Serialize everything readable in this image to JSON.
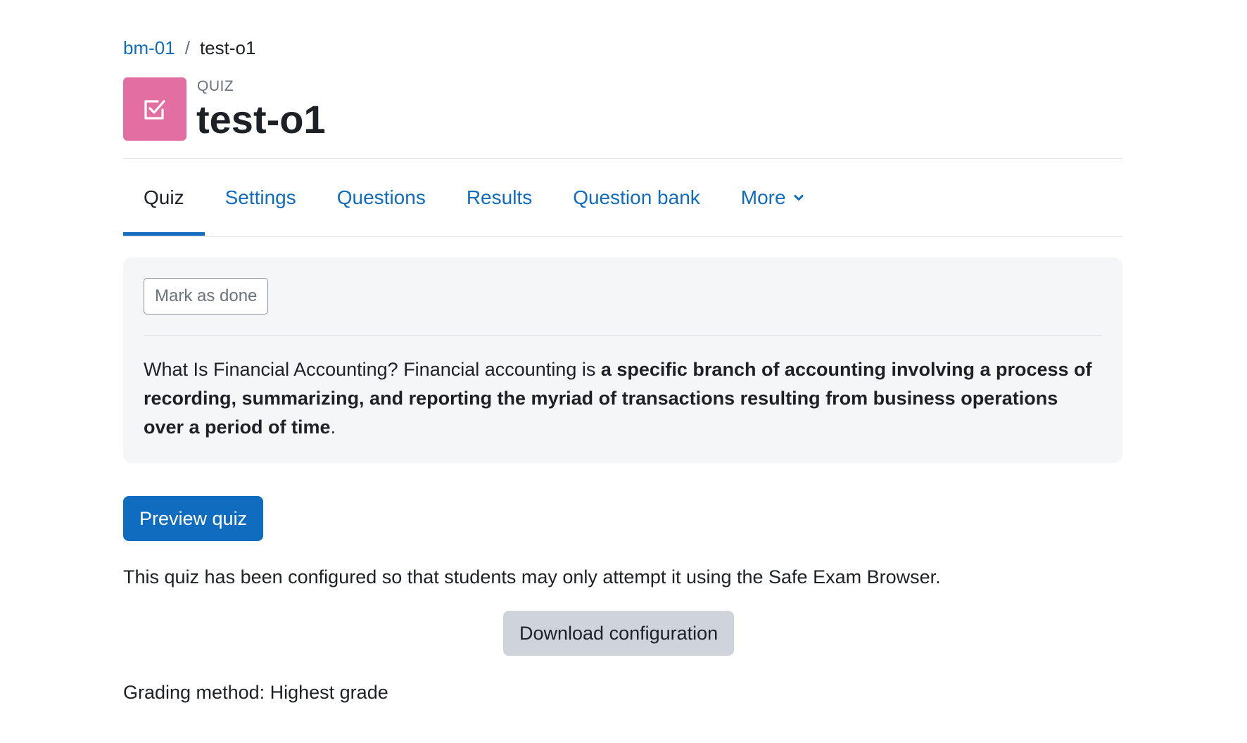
{
  "breadcrumb": {
    "course_link": "bm-01",
    "separator": "/",
    "current": "test-o1"
  },
  "header": {
    "icon": "quiz-checkbox-icon",
    "icon_bg_color": "#e36fa2",
    "activity_type": "QUIZ",
    "title": "test-o1"
  },
  "tabs": [
    {
      "label": "Quiz",
      "active": true
    },
    {
      "label": "Settings",
      "active": false
    },
    {
      "label": "Questions",
      "active": false
    },
    {
      "label": "Results",
      "active": false
    },
    {
      "label": "Question bank",
      "active": false
    },
    {
      "label": "More",
      "active": false,
      "icon": "chevron-down-icon"
    }
  ],
  "activity_card": {
    "mark_done_label": "Mark as done",
    "intro": {
      "lead": "What Is Financial Accounting? Financial accounting is ",
      "bold": "a specific branch of accounting involving a process of recording, summarizing, and reporting the myriad of transactions resulting from business operations over a period of time",
      "tail": "."
    }
  },
  "preview_button": "Preview quiz",
  "seb_notice": "This quiz has been configured so that students may only attempt it using the Safe Exam Browser.",
  "download_button": "Download configuration",
  "grading_method": "Grading method: Highest grade",
  "colors": {
    "link": "#0f6cbf",
    "primary_button": "#0f6cbf",
    "secondary_button": "#ced4da",
    "card_background": "#f5f6f8"
  }
}
